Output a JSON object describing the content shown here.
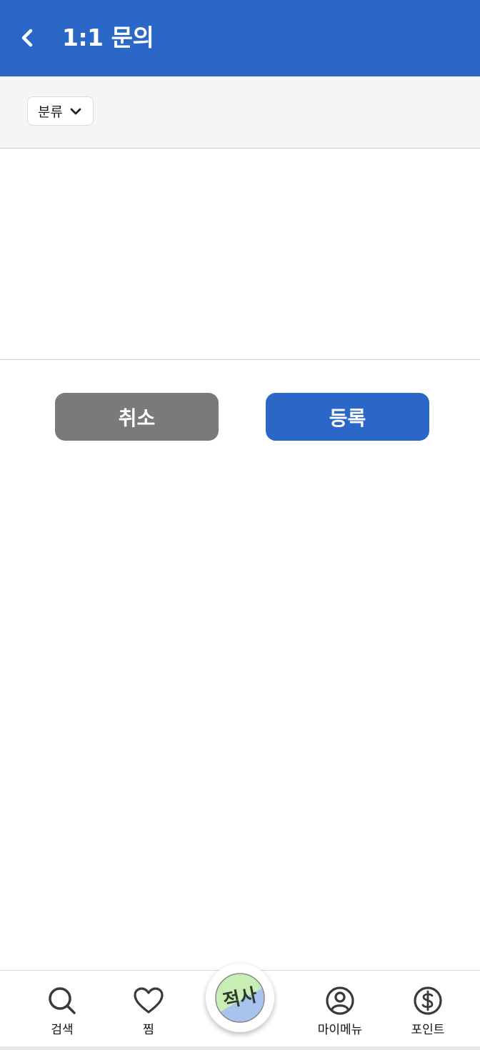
{
  "header": {
    "title": "1:1 문의"
  },
  "category": {
    "label": "분류"
  },
  "form": {
    "content_value": "",
    "cancel_label": "취소",
    "submit_label": "등록"
  },
  "nav": {
    "search_label": "검색",
    "fav_label": "찜",
    "logo_text": "적사",
    "mymenu_label": "마이메뉴",
    "point_label": "포인트"
  },
  "colors": {
    "primary": "#2b67c6",
    "cancel": "#7a7a7a",
    "logo_green": "#c7efb5",
    "logo_blue": "#a7c4ef",
    "icon_dark": "#3a3a3a"
  },
  "icons": {
    "back": "chevron-left-icon",
    "dropdown": "chevron-down-icon",
    "search": "search-icon",
    "fav": "heart-icon",
    "mymenu": "user-circle-icon",
    "point": "dollar-circle-icon"
  }
}
